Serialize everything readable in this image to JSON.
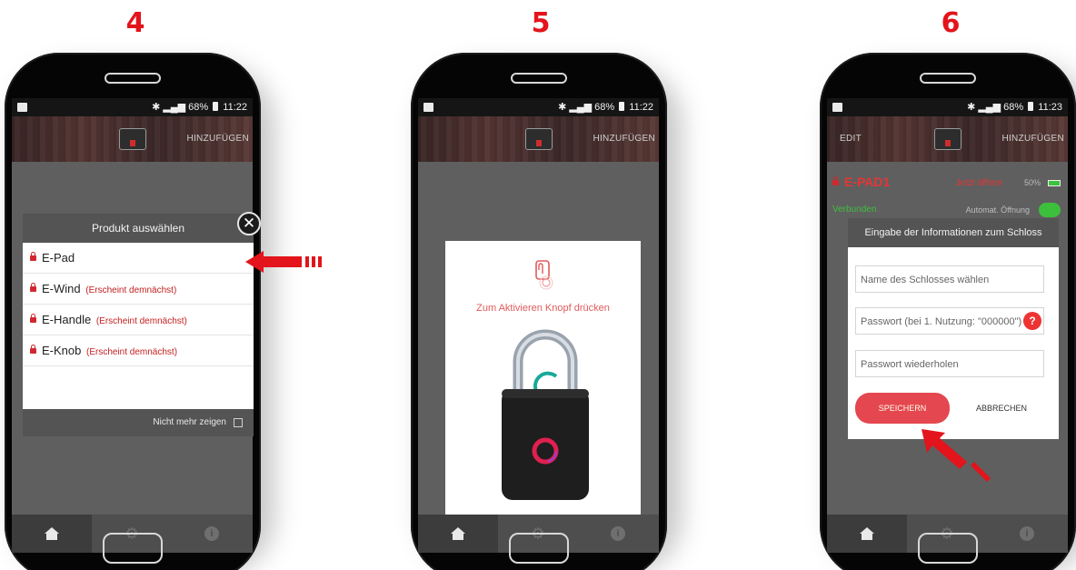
{
  "steps": [
    "4",
    "5",
    "6"
  ],
  "status_bar": {
    "screen1": "68%",
    "screen1_time": "11:22",
    "screen2": "68%",
    "screen2_time": "11:22",
    "screen3": "68%",
    "screen3_time": "11:23"
  },
  "app_bar": {
    "add_label": "HINZUFÜGEN",
    "edit_label": "EDIT"
  },
  "product_modal": {
    "title": "Produkt auswählen",
    "items": [
      {
        "name": "E-Pad",
        "note": ""
      },
      {
        "name": "E-Wind",
        "note": "(Erscheint demnächst)"
      },
      {
        "name": "E-Handle",
        "note": "(Erscheint demnächst)"
      },
      {
        "name": "E-Knob",
        "note": "(Erscheint demnächst)"
      }
    ],
    "dont_show": "Nicht mehr zeigen"
  },
  "activate": {
    "text": "Zum Aktivieren Knopf drücken"
  },
  "lock_screen": {
    "name": "E-PAD1",
    "open_now": "Jetzt öffnen",
    "battery": "50%",
    "connected": "Verbunden",
    "auto_open": "Automat. Öffnung"
  },
  "lock_dialog": {
    "title": "Eingabe der Informationen zum Schloss",
    "name_placeholder": "Name des Schlosses wählen",
    "password_placeholder": "Passwort (bei 1. Nutzung: \"000000\")",
    "repeat_placeholder": "Passwort wiederholen",
    "save": "SPEICHERN",
    "cancel": "ABBRECHEN"
  },
  "colors": {
    "accent": "#e3141b",
    "green": "#3cbf3c"
  }
}
